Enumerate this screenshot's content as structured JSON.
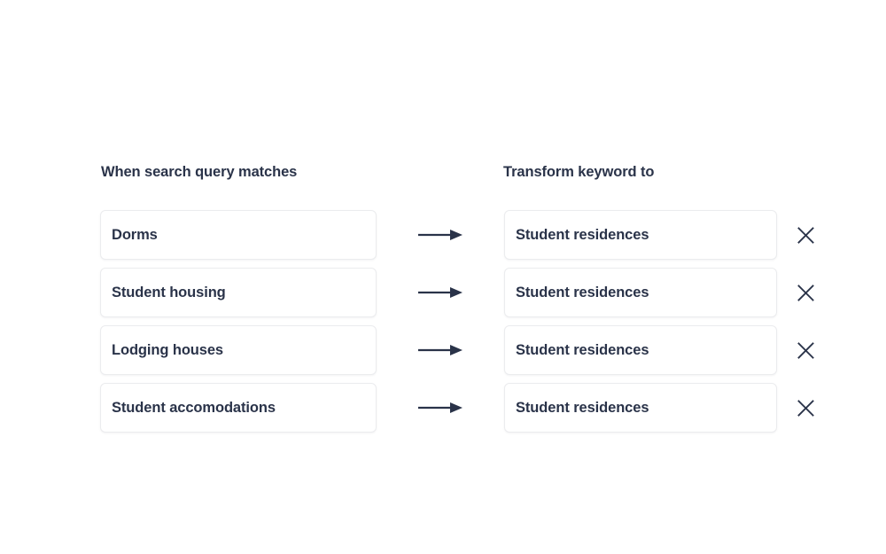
{
  "panel": {
    "title": "synonym-mapping-panel",
    "columns": {
      "source_header": "When search query matches",
      "target_header": "Transform keyword to"
    },
    "colors": {
      "text": "#2a3349",
      "border": "#ebecee",
      "background": "#ffffff",
      "icon": "#2a3349"
    },
    "rows": [
      {
        "source": "Dorms",
        "target": "Student residences",
        "arrow_icon": "arrow-right-icon",
        "remove_icon": "close-icon"
      },
      {
        "source": "Student housing",
        "target": "Student residences",
        "arrow_icon": "arrow-right-icon",
        "remove_icon": "close-icon"
      },
      {
        "source": "Lodging houses",
        "target": "Student residences",
        "arrow_icon": "arrow-right-icon",
        "remove_icon": "close-icon"
      },
      {
        "source": "Student accomodations",
        "target": "Student residences",
        "arrow_icon": "arrow-right-icon",
        "remove_icon": "close-icon"
      }
    ]
  }
}
